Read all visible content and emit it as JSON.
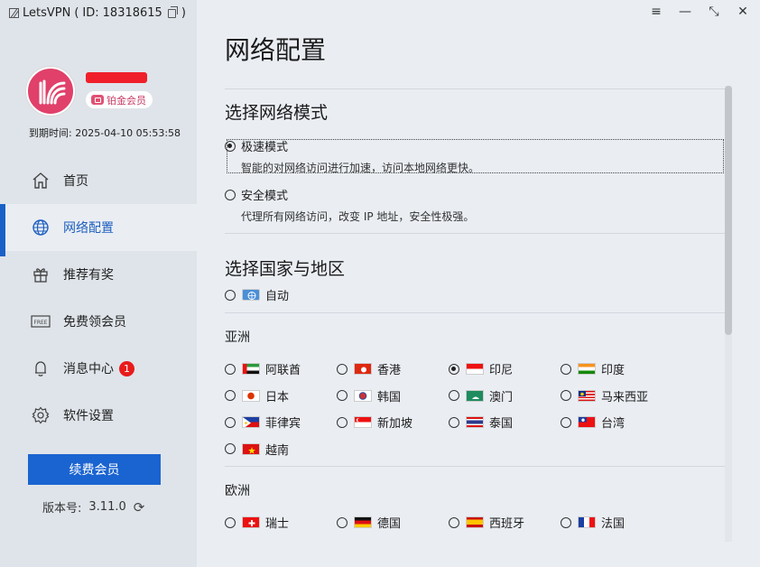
{
  "window": {
    "app_name": "LetsVPN",
    "id_label": "ID:",
    "id_value": "18318615",
    "controls": [
      "menu-icon",
      "minimize-icon",
      "restore-icon",
      "close-icon"
    ]
  },
  "user": {
    "membership": "铂金会员",
    "expire_label": "到期时间:",
    "expire_value": "2025-04-10 05:53:58"
  },
  "nav": [
    {
      "label": "首页",
      "icon": "home-icon"
    },
    {
      "label": "网络配置",
      "icon": "globe-icon",
      "active": true
    },
    {
      "label": "推荐有奖",
      "icon": "gift-icon"
    },
    {
      "label": "免费领会员",
      "icon": "free-icon"
    },
    {
      "label": "消息中心",
      "icon": "bell-icon",
      "badge": "1"
    },
    {
      "label": "软件设置",
      "icon": "gear-icon"
    }
  ],
  "renew_label": "续费会员",
  "version": {
    "label": "版本号:",
    "value": "3.11.0"
  },
  "page": {
    "title": "网络配置"
  },
  "network_mode": {
    "heading": "选择网络模式",
    "options": [
      {
        "label": "极速模式",
        "desc": "智能的对网络访问进行加速，访问本地网络更快。",
        "selected": true
      },
      {
        "label": "安全模式",
        "desc": "代理所有网络访问，改变 IP 地址，安全性极强。",
        "selected": false
      }
    ]
  },
  "country": {
    "heading": "选择国家与地区",
    "auto_label": "自动",
    "regions": [
      {
        "name": "亚洲",
        "countries": [
          {
            "name": "阿联酋",
            "flag": "ae"
          },
          {
            "name": "香港",
            "flag": "hk"
          },
          {
            "name": "印尼",
            "flag": "id",
            "selected": true
          },
          {
            "name": "印度",
            "flag": "in"
          },
          {
            "name": "日本",
            "flag": "jp"
          },
          {
            "name": "韩国",
            "flag": "kr"
          },
          {
            "name": "澳门",
            "flag": "mo"
          },
          {
            "name": "马来西亚",
            "flag": "my"
          },
          {
            "name": "菲律宾",
            "flag": "ph"
          },
          {
            "name": "新加坡",
            "flag": "sg"
          },
          {
            "name": "泰国",
            "flag": "th"
          },
          {
            "name": "台湾",
            "flag": "tw"
          },
          {
            "name": "越南",
            "flag": "vn"
          }
        ]
      },
      {
        "name": "欧洲",
        "countries": [
          {
            "name": "瑞士",
            "flag": "ch"
          },
          {
            "name": "德国",
            "flag": "de"
          },
          {
            "name": "西班牙",
            "flag": "es"
          },
          {
            "name": "法国",
            "flag": "fr"
          }
        ]
      }
    ]
  },
  "colors": {
    "accent": "#1a64d1",
    "sidebar_bg": "#dfe4ea",
    "main_bg": "#eaeef3",
    "badge_red": "#e81b1b",
    "avatar": "#e0406a"
  }
}
